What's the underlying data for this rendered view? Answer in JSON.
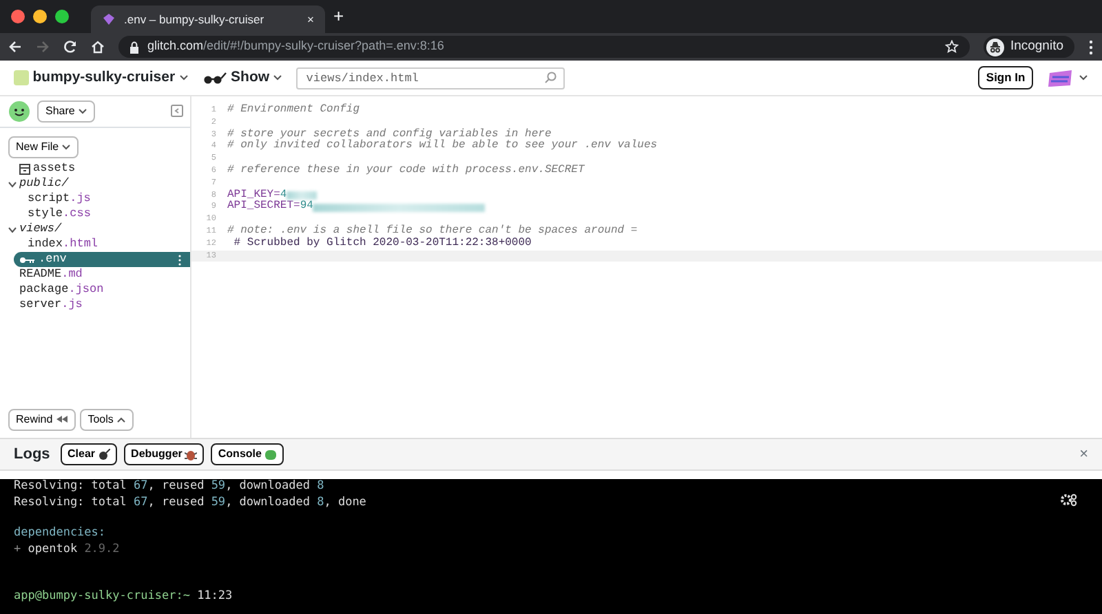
{
  "browser": {
    "tab_title": ".env – bumpy-sulky-cruiser",
    "tab_close": "×",
    "new_tab": "+",
    "back_disabled": false,
    "forward_disabled": true,
    "url": {
      "host": "glitch.com",
      "path": "/edit/#!/bumpy-sulky-cruiser?path=.env:8:16"
    },
    "profile": "Incognito"
  },
  "header": {
    "project": "bumpy-sulky-cruiser",
    "show": "Show",
    "search": {
      "placeholder": "views/index.html"
    },
    "sign_in": "Sign In"
  },
  "sidebar": {
    "share": "Share",
    "new_file": "New File",
    "files": [
      {
        "name": "assets",
        "kind": "assets",
        "selected": false
      },
      {
        "name": "public/",
        "kind": "folder",
        "expanded": true,
        "children": [
          {
            "name": "script.js",
            "kind": "file",
            "selected": false
          },
          {
            "name": "style.css",
            "kind": "file",
            "selected": false
          }
        ]
      },
      {
        "name": "views/",
        "kind": "folder",
        "expanded": true,
        "children": [
          {
            "name": "index.html",
            "kind": "file",
            "selected": false
          }
        ]
      },
      {
        "name": ".env",
        "kind": "env",
        "selected": true
      },
      {
        "name": "README.md",
        "kind": "file",
        "selected": false
      },
      {
        "name": "package.json",
        "kind": "file",
        "selected": false
      },
      {
        "name": "server.js",
        "kind": "file",
        "selected": false
      }
    ],
    "rewind": "Rewind",
    "tools": "Tools"
  },
  "editor": {
    "lines": [
      {
        "num": "1",
        "kind": "comment",
        "text": "# Environment Config"
      },
      {
        "num": "2",
        "kind": "blank"
      },
      {
        "num": "3",
        "kind": "comment",
        "text": "# store your secrets and config variables in here"
      },
      {
        "num": "4",
        "kind": "comment",
        "text": "# only invited collaborators will be able to see your .env values"
      },
      {
        "num": "5",
        "kind": "blank"
      },
      {
        "num": "6",
        "kind": "comment",
        "text": "# reference these in your code with process.env.SECRET"
      },
      {
        "num": "7",
        "kind": "blank"
      },
      {
        "num": "8",
        "kind": "secret",
        "key": "API_KEY=",
        "value": "4"
      },
      {
        "num": "9",
        "kind": "secret",
        "key": "API_SECRET=",
        "value": "94"
      },
      {
        "num": "10",
        "kind": "blank"
      },
      {
        "num": "11",
        "kind": "comment",
        "text": "# note: .env is a shell file so there can't be spaces around ="
      },
      {
        "num": "12",
        "kind": "scrub",
        "text": " # Scrubbed by Glitch 2020-03-20T11:22:38+0000"
      },
      {
        "num": "13",
        "kind": "blank",
        "current": true
      }
    ]
  },
  "logs": {
    "title": "Logs",
    "buttons": [
      "Clear",
      "Debugger",
      "Console"
    ],
    "close": "×"
  },
  "terminal": {
    "lines": [
      {
        "kind": "plain",
        "text": "Resolving: total 67, reused 59, downloaded 8"
      },
      {
        "kind": "plain",
        "text": "Resolving: total 67, reused 59, downloaded 8, done"
      },
      {
        "kind": "heading",
        "text": "dependencies:"
      },
      {
        "kind": "dep",
        "mark": "+",
        "name": "opentok",
        "version": "2.9.2"
      }
    ],
    "prompt": {
      "user": "app@bumpy-sulky-cruiser:~",
      "time": "11:23"
    }
  }
}
